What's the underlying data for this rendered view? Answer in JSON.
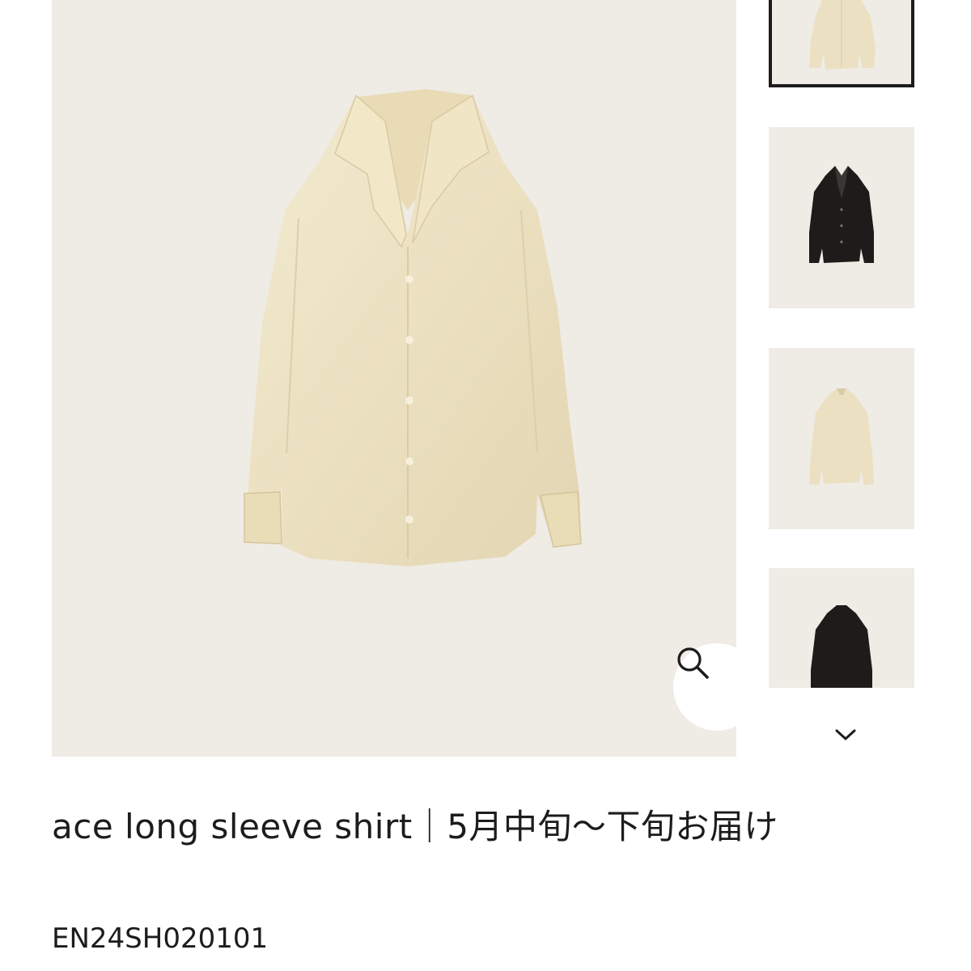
{
  "product": {
    "title": "ace long sleeve shirt｜5月中旬〜下旬お届け",
    "code": "EN24SH020101"
  },
  "gallery": {
    "main_image_alt": "ace long sleeve shirt",
    "zoom_icon": "search-icon",
    "scroll_icon": "chevron-down-icon",
    "thumbnails": [
      {
        "color": "ivory",
        "selected": true
      },
      {
        "color": "black",
        "selected": false
      },
      {
        "color": "ivory",
        "selected": false
      },
      {
        "color": "black",
        "selected": false
      }
    ]
  },
  "colors": {
    "background": "#efebe5",
    "shirt_ivory": "#ede3c4",
    "shirt_black": "#1e1c1b",
    "text": "#1c1c1c"
  }
}
